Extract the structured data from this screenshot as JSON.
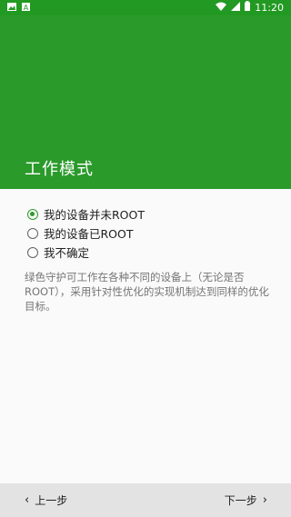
{
  "status_bar": {
    "left_icons": [
      "image-icon",
      "a-letter-icon"
    ],
    "right_icons": [
      "wifi-icon",
      "signal-icon",
      "battery-icon"
    ],
    "time": "11:20"
  },
  "header": {
    "title": "工作模式",
    "color": "#2a9a2a"
  },
  "options": [
    {
      "label": "我的设备并未ROOT",
      "selected": true
    },
    {
      "label": "我的设备已ROOT",
      "selected": false
    },
    {
      "label": "我不确定",
      "selected": false
    }
  ],
  "description": "绿色守护可工作在各种不同的设备上（无论是否ROOT），采用针对性优化的实现机制达到同样的优化目标。",
  "footer": {
    "prev_label": "上一步",
    "next_label": "下一步"
  }
}
